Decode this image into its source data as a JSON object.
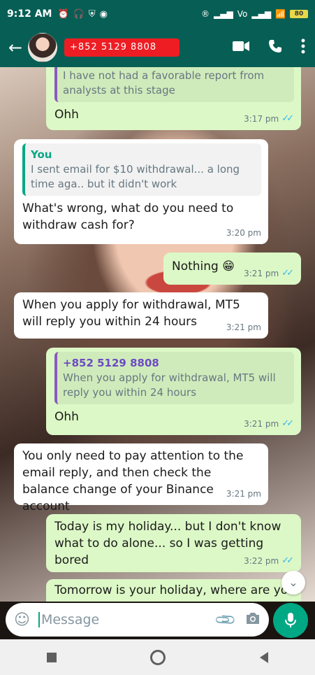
{
  "status": {
    "time": "9:12 AM",
    "left_icons": [
      "alarm-off-icon",
      "headset-icon",
      "shield-icon",
      "message-icon"
    ],
    "right_icons": [
      "r-badge-icon",
      "signal-icon",
      "vowifi-icon",
      "signal-icon",
      "wifi-icon"
    ],
    "battery": "80"
  },
  "header": {
    "contact_name": "+852 5129 8808"
  },
  "messages": [
    {
      "dir": "out",
      "quote_text": "I have not had a favorable report from analysts at this stage",
      "text": "Ohh",
      "time": "3:17 pm",
      "ticks": "✓✓"
    },
    {
      "dir": "in",
      "quote_author": "You",
      "quote_text": "I sent email for $10 withdrawal... a long time aga.. but it didn't work",
      "text": "What's wrong, what do you need to withdraw cash for?",
      "time": "3:20 pm"
    },
    {
      "dir": "out",
      "text": "Nothing 😁",
      "time": "3:21 pm",
      "ticks": "✓✓"
    },
    {
      "dir": "in",
      "text": "When you apply for withdrawal, MT5 will reply you within 24 hours",
      "time": "3:21 pm"
    },
    {
      "dir": "out",
      "quote_author": "+852 5129 8808",
      "quote_text": "When you apply for withdrawal, MT5 will reply you within 24 hours",
      "text": "Ohh",
      "time": "3:21 pm",
      "ticks": "✓✓"
    },
    {
      "dir": "in",
      "text": "You only need to pay attention to the email reply, and then check the balance change of your Binance account",
      "time": "3:21 pm"
    },
    {
      "dir": "out",
      "text": "Today is my holiday... but I don't know what to do alone... so I was getting bored",
      "time": "3:22 pm",
      "ticks": "✓✓"
    },
    {
      "dir": "out",
      "text": "Tomorrow is your holiday, where are you",
      "time": "",
      "ticks": ""
    }
  ],
  "input": {
    "placeholder": "Message"
  },
  "colors": {
    "header": "#075e54",
    "outgoing_bubble": "#dcf8c6",
    "incoming_bubble": "#ffffff",
    "accent": "#00a884",
    "tick": "#34b7f1",
    "name_redaction": "#ee1d23"
  }
}
